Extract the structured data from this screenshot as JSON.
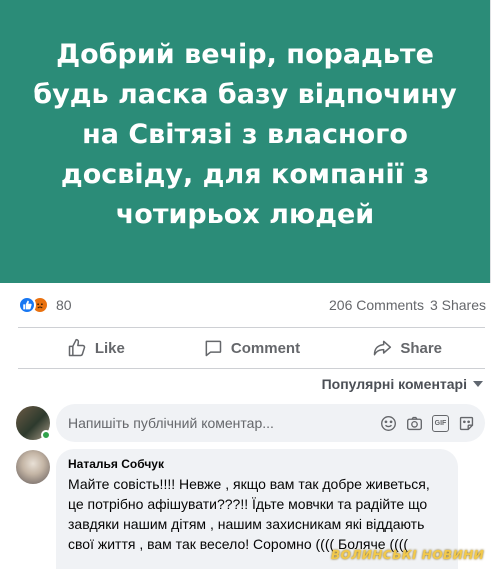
{
  "post": {
    "banner_text": "Добрий вечір, порадьте будь ласка базу відпочину на Світязі з власного досвіду, для компанії з чотирьох людей",
    "banner_color": "#2b8c78"
  },
  "stats": {
    "reaction_count": "80",
    "comments": "206 Comments",
    "shares": "3 Shares"
  },
  "actions": {
    "like": "Like",
    "comment": "Comment",
    "share": "Share"
  },
  "comments_section": {
    "sort_label": "Популярні коментарі",
    "composer_placeholder": "Напишіть публічний коментар..."
  },
  "comment": {
    "author": "Наталья Собчук",
    "text": "Майте совість!!!! Невже , якщо вам так добре живеться, це потрібно афішувати???!! Їдьте мовчки та радійте що завдяки нашим дітям , нашим захисникам які віддають свої життя , вам так весело! Соромно (((( Боляче (((("
  },
  "watermark": "ВОЛИНСЬКІ НОВИНИ",
  "colors": {
    "accent": "#1877f2",
    "online": "#31a24c",
    "muted_text": "#65676b"
  }
}
